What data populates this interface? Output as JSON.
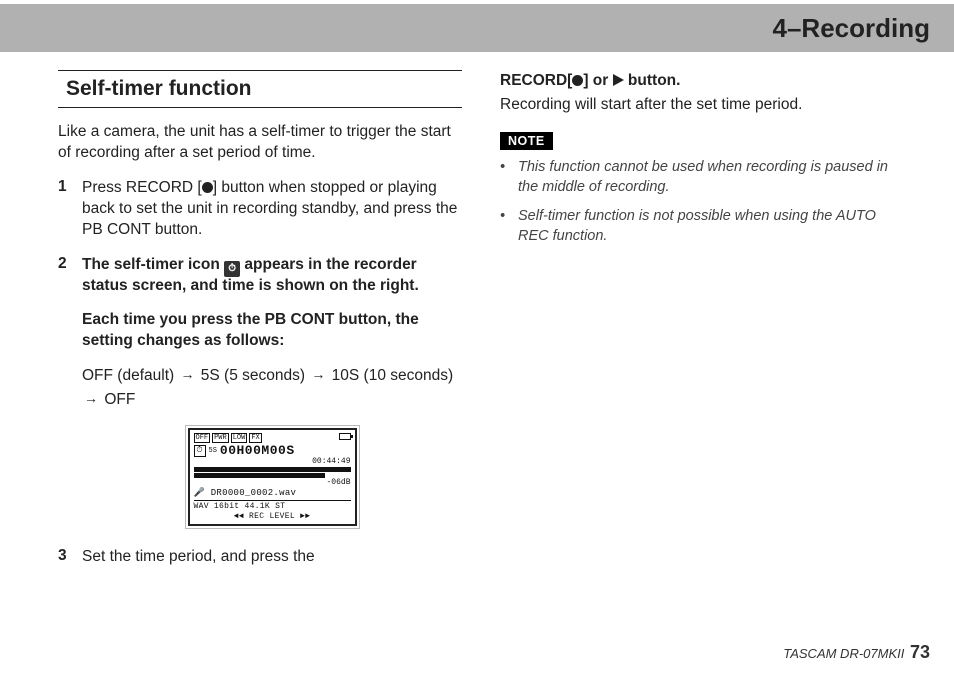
{
  "header": {
    "chapter": "4–Recording"
  },
  "left": {
    "section_heading": "Self-timer function",
    "intro": "Like a camera, the unit has a self-timer to trigger the start of recording after a set period of time.",
    "step1": {
      "num": "1",
      "t1": "Press RECORD [",
      "t2": "] button when stopped or playing back to set the unit in recording standby, and press the PB CONT button."
    },
    "step2": {
      "num": "2",
      "t1": "The self-timer icon ",
      "t2": " appears in the recorder status screen, and time is shown on the right.",
      "extra": "Each time you press the PB CONT button, the setting changes as follows:",
      "seq": {
        "a": "OFF (default)",
        "b": "5S (5 seconds)",
        "c": "10S (10 seconds)",
        "d": "OFF"
      }
    },
    "step3": {
      "num": "3",
      "text": "Set the time period, and press the"
    },
    "lcd": {
      "tags": {
        "a": "OFF",
        "b": "PWR",
        "c": "LOW",
        "d": "FX"
      },
      "five_s": "5S",
      "big_time": "00H00M00S",
      "small_time": "00:44:49",
      "db": "-06dB",
      "file": "DR0000_0002.wav",
      "fmt": "WAV 16bit 44.1K ST",
      "reclevel": "◄◄ REC LEVEL ►►"
    }
  },
  "right": {
    "line1a": "RECORD[",
    "line1b": "] or ",
    "line1c": " button.",
    "line2": "Recording will start after the set time period.",
    "note_label": "NOTE",
    "note1": "This function cannot be used when recording is paused in the middle of recording.",
    "note2": "Self-timer function is not possible when using the AUTO REC function."
  },
  "footer": {
    "model": "TASCAM DR-07MKII",
    "page": "73"
  }
}
